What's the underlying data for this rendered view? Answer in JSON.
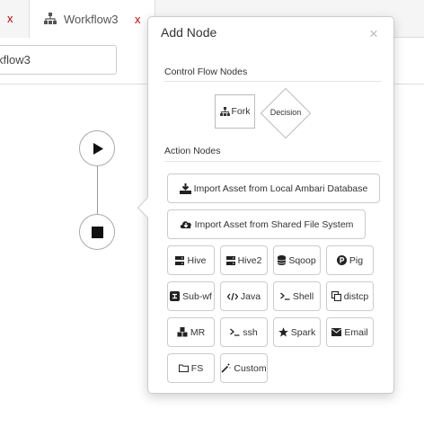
{
  "tabs": [
    {
      "close": "x"
    },
    {
      "label": "Workflow3",
      "close": "x",
      "icon": "sitemap-icon"
    }
  ],
  "workflow_name": {
    "value": "kflow3"
  },
  "canvas": {
    "nodes": [
      "play-icon",
      "stop-icon"
    ]
  },
  "popover": {
    "title": "Add Node",
    "close": "×",
    "control_flow": {
      "heading": "Control Flow Nodes",
      "fork": {
        "label": "Fork",
        "icon": "sitemap-icon"
      },
      "decision": {
        "label": "Decision"
      }
    },
    "action": {
      "heading": "Action Nodes",
      "import_ambari": {
        "label": "Import Asset from Local Ambari Database",
        "icon": "download-icon"
      },
      "import_shared": {
        "label": "Import Asset from Shared File System",
        "icon": "cloud-download-icon"
      },
      "nodes": [
        {
          "label": "Hive",
          "icon": "server-icon"
        },
        {
          "label": "Hive2",
          "icon": "server-icon"
        },
        {
          "label": "Sqoop",
          "icon": "database-icon"
        },
        {
          "label": "Pig",
          "icon": "p-circle-icon"
        },
        {
          "label": "Sub-wf",
          "icon": "sub-workflow-icon"
        },
        {
          "label": "Java",
          "icon": "code-icon"
        },
        {
          "label": "Shell",
          "icon": "terminal-icon"
        },
        {
          "label": "distcp",
          "icon": "copy-icon"
        },
        {
          "label": "MR",
          "icon": "cubes-icon"
        },
        {
          "label": "ssh",
          "icon": "terminal-icon"
        },
        {
          "label": "Spark",
          "icon": "star-icon"
        },
        {
          "label": "Email",
          "icon": "envelope-icon"
        },
        {
          "label": "FS",
          "icon": "folder-icon"
        },
        {
          "label": "Custom",
          "icon": "magic-icon"
        }
      ]
    }
  }
}
